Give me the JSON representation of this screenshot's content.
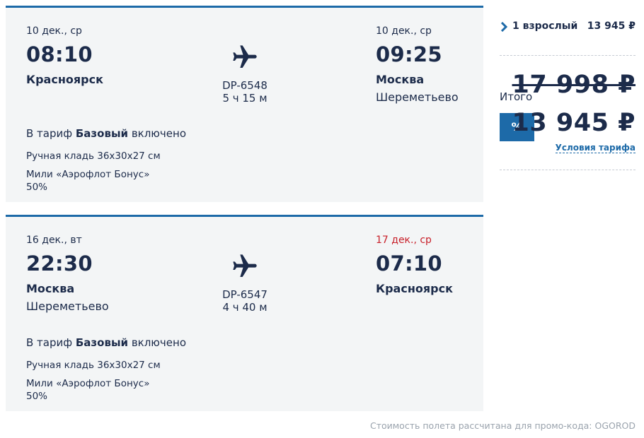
{
  "colors": {
    "accent": "#1d6aa8",
    "text": "#1c2b4a",
    "date_red": "#c8202a",
    "card_bg": "#f3f5f6",
    "footnote": "#9aa3ad"
  },
  "segments": [
    {
      "dep": {
        "date": "10 дек., ср",
        "time": "08:10",
        "city": "Красноярск",
        "airport": ""
      },
      "flight_no": "DP-6548",
      "duration": "5 ч 15 м",
      "arr": {
        "date": "10 дек., ср",
        "time": "09:25",
        "city": "Москва",
        "airport": "Шереметьево"
      },
      "tariff_prefix": "В тариф",
      "tariff_name": "Базовый",
      "tariff_suffix": "включено",
      "features": [
        "Ручная кладь 36x30x27 см",
        "Мили «Аэрофлот Бонус»",
        "50%"
      ]
    },
    {
      "dep": {
        "date": "16 дек., вт",
        "time": "22:30",
        "city": "Москва",
        "airport": "Шереметьево"
      },
      "flight_no": "DP-6547",
      "duration": "4 ч 40 м",
      "arr": {
        "date": "17 дек., ср",
        "time": "07:10",
        "city": "Красноярск",
        "airport": ""
      },
      "tariff_prefix": "В тариф",
      "tariff_name": "Базовый",
      "tariff_suffix": "включено",
      "features": [
        "Ручная кладь 36x30x27 см",
        "Мили «Аэрофлот Бонус»",
        "50%"
      ]
    }
  ],
  "summary": {
    "passengers_label": "1 взрослый",
    "passengers_price": "13 945 ₽",
    "total_label": "Итого",
    "old_price": "17 998 ₽",
    "promo_badge": "%",
    "new_price": "13 945 ₽",
    "conditions_link": "Условия тарифа"
  },
  "footnote": "Стоимость полета рассчитана для промо-кода: OGOROD"
}
